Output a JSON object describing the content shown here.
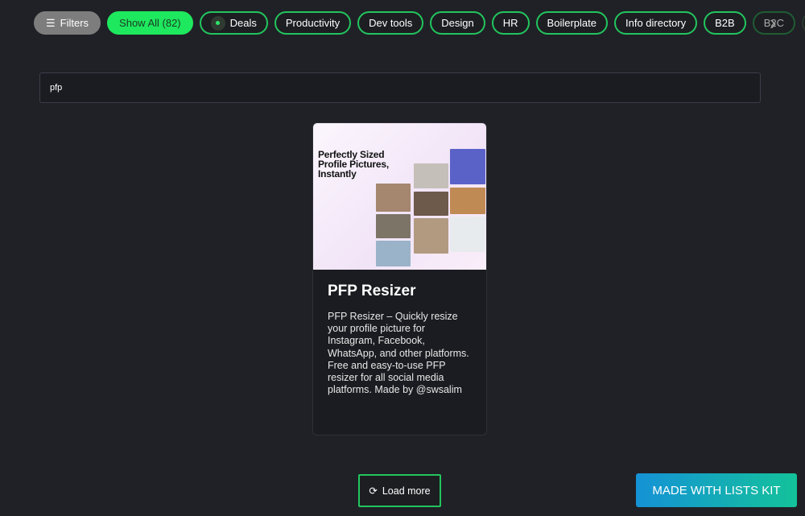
{
  "filters": {
    "filters_label": "Filters",
    "show_all": "Show All (82)",
    "categories": [
      "Deals",
      "Productivity",
      "Dev tools",
      "Design",
      "HR",
      "Boilerplate",
      "Info directory",
      "B2B",
      "B2C"
    ]
  },
  "search": {
    "value": "pfp"
  },
  "cards": [
    {
      "thumb_headline": "Perfectly Sized Profile Pictures, Instantly",
      "title": "PFP Resizer",
      "description": "PFP Resizer – Quickly resize your profile picture for Instagram, Facebook, WhatsApp, and other platforms. Free and easy-to-use PFP resizer for all social media platforms. Made by @swsalim"
    }
  ],
  "load_more": "Load more",
  "made_with": "MADE WITH LISTS KIT",
  "colors": {
    "accent": "#22c55e",
    "active": "#1ee85e",
    "background": "#202126"
  }
}
